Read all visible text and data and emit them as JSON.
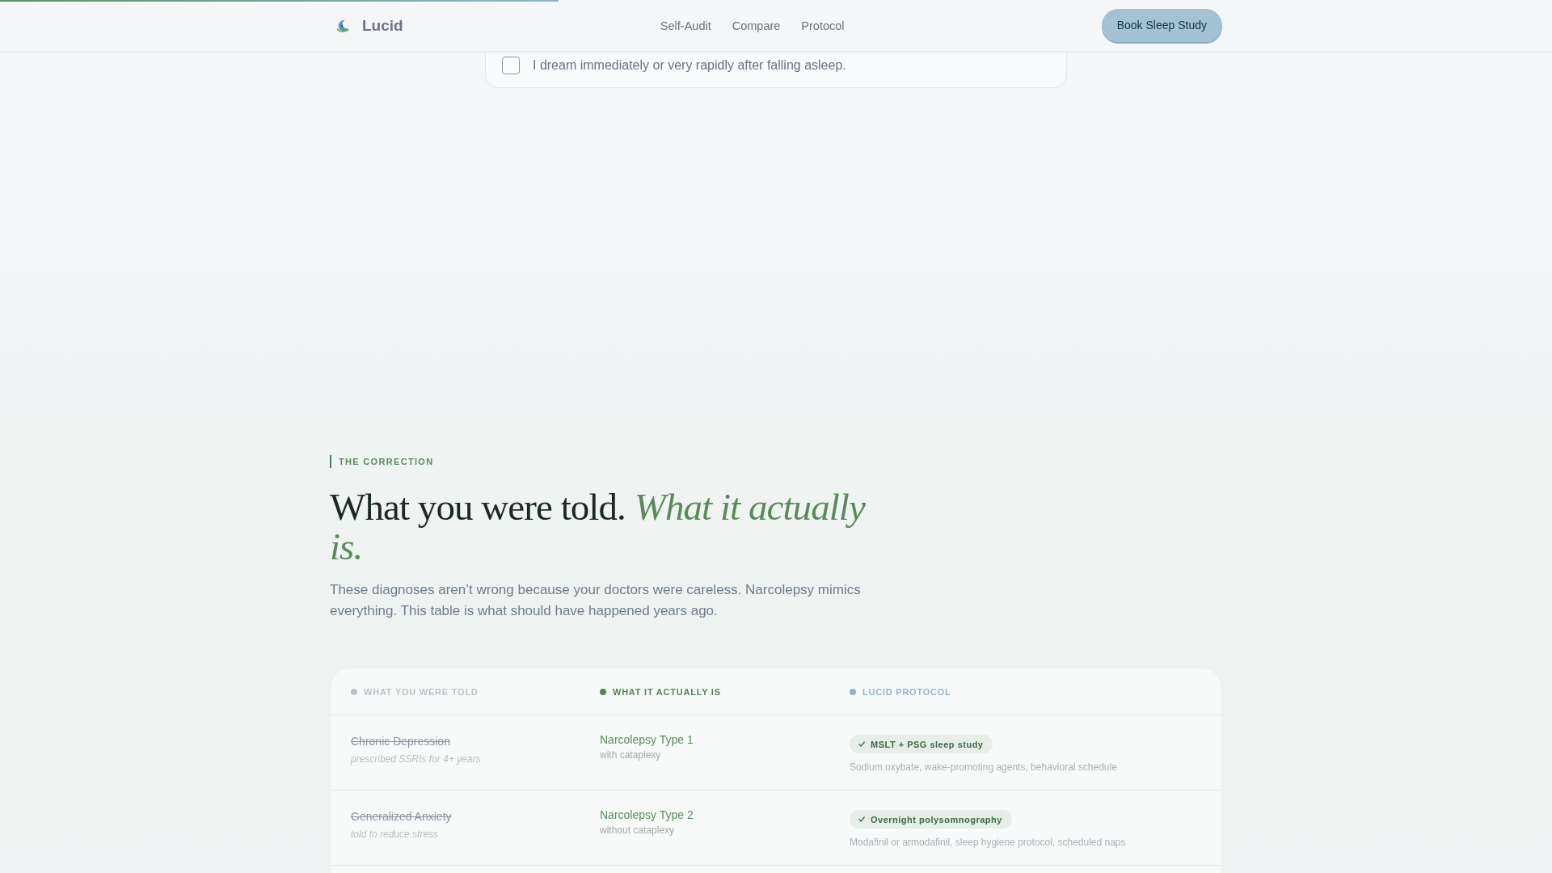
{
  "progress": {
    "level": 0.36
  },
  "navbar": {
    "brand": "Lucid",
    "links": [
      "Self-Audit",
      "Compare",
      "Protocol"
    ],
    "cta": "Book Sleep Study"
  },
  "question_card": {
    "items": [
      {
        "label": "I dream immediately or very rapidly after falling asleep.",
        "checked": false
      }
    ]
  },
  "section": {
    "eyebrow": "THE CORRECTION",
    "title": "What you were told. *What it actually is.*",
    "lead": "These diagnoses aren’t wrong because your doctors were careless. Narcolepsy mimics everything. This table is what should have happened years ago."
  },
  "table": {
    "columns": [
      {
        "label": "WHAT YOU WERE TOLD",
        "color": "#bcc2c9"
      },
      {
        "label": "WHAT IT ACTUALLY IS",
        "color": "#54845a"
      },
      {
        "label": "LUCID PROTOCOL",
        "color": "#93b4ca"
      }
    ],
    "rows": [
      {
        "told": "Chronic Depression",
        "told_note": "prescribed SSRIs for 4+ years",
        "actual": "Narcolepsy Type 1",
        "actual_note": "with cataplexy",
        "protocol": "MSLT + PSG sleep study",
        "protocol_note": "Sodium oxybate, wake-promoting agents, behavioral schedule"
      },
      {
        "told": "Generalized Anxiety",
        "told_note": "told to reduce stress",
        "actual": "Narcolepsy Type 2",
        "actual_note": "without cataplexy",
        "protocol": "Overnight polysomnography",
        "protocol_note": "Modafinil or armodafinil, sleep hygiene protocol, scheduled naps"
      }
    ]
  }
}
